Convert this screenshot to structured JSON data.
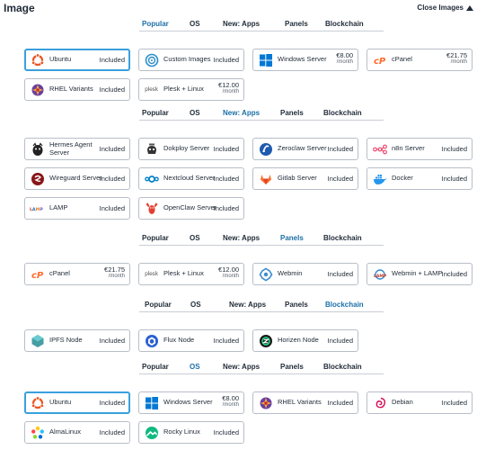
{
  "header": {
    "title": "Image",
    "close_label": "Close Images"
  },
  "tab_labels": {
    "popular": "Popular",
    "os": "OS",
    "apps": "New: Apps",
    "panels": "Panels",
    "blockchain": "Blockchain"
  },
  "sections": [
    {
      "active": "popular",
      "cards": [
        {
          "name": "Ubuntu",
          "price": "Included",
          "icon": "ubuntu-icon",
          "selected": true
        },
        {
          "name": "Custom Images",
          "price": "Included",
          "icon": "custom-images-icon"
        },
        {
          "name": "Windows Server",
          "price": "€8.00",
          "per": "/month",
          "icon": "windows-icon"
        },
        {
          "name": "cPanel",
          "price": "€21.75",
          "per": "/month",
          "icon": "cpanel-icon"
        },
        {
          "name": "RHEL Variants",
          "price": "Included",
          "icon": "rhel-icon"
        },
        {
          "name": "Plesk + Linux",
          "price": "€12.00",
          "per": "/month",
          "icon": "plesk-icon"
        }
      ]
    },
    {
      "active": "apps",
      "cards": [
        {
          "name": "Hermes Agent Server",
          "price": "Included",
          "icon": "hermes-icon"
        },
        {
          "name": "Dokploy Server",
          "price": "Included",
          "icon": "dokploy-icon"
        },
        {
          "name": "Zeroclaw Server",
          "price": "Included",
          "icon": "zeroclaw-icon"
        },
        {
          "name": "n8n Server",
          "price": "Included",
          "icon": "n8n-icon"
        },
        {
          "name": "Wireguard Server",
          "price": "Included",
          "icon": "wireguard-icon"
        },
        {
          "name": "Nextcloud Server",
          "price": "Included",
          "icon": "nextcloud-icon"
        },
        {
          "name": "Gitlab Server",
          "price": "Included",
          "icon": "gitlab-icon"
        },
        {
          "name": "Docker",
          "price": "Included",
          "icon": "docker-icon"
        },
        {
          "name": "LAMP",
          "price": "Included",
          "icon": "lamp-icon"
        },
        {
          "name": "OpenClaw Server",
          "price": "Included",
          "icon": "openclaw-icon"
        }
      ]
    },
    {
      "active": "panels",
      "cards": [
        {
          "name": "cPanel",
          "price": "€21.75",
          "per": "/month",
          "icon": "cpanel-icon"
        },
        {
          "name": "Plesk + Linux",
          "price": "€12.00",
          "per": "/month",
          "icon": "plesk-icon"
        },
        {
          "name": "Webmin",
          "price": "Included",
          "icon": "webmin-icon"
        },
        {
          "name": "Webmin + LAMP",
          "price": "Included",
          "icon": "webmin-lamp-icon"
        }
      ]
    },
    {
      "active": "blockchain",
      "cards": [
        {
          "name": "IPFS Node",
          "price": "Included",
          "icon": "ipfs-icon"
        },
        {
          "name": "Flux Node",
          "price": "Included",
          "icon": "flux-icon"
        },
        {
          "name": "Horizen Node",
          "price": "Included",
          "icon": "horizen-icon"
        }
      ]
    },
    {
      "active": "os",
      "cards": [
        {
          "name": "Ubuntu",
          "price": "Included",
          "icon": "ubuntu-icon",
          "selected": true
        },
        {
          "name": "Windows Server",
          "price": "€8.00",
          "per": "/month",
          "icon": "windows-icon"
        },
        {
          "name": "RHEL Variants",
          "price": "Included",
          "icon": "rhel-icon"
        },
        {
          "name": "Debian",
          "price": "Included",
          "icon": "debian-icon"
        },
        {
          "name": "AlmaLinux",
          "price": "Included",
          "icon": "almalinux-icon"
        },
        {
          "name": "Rocky Linux",
          "price": "Included",
          "icon": "rockylinux-icon"
        }
      ]
    }
  ],
  "plesk_logo_text": "plesk",
  "colors": {
    "accent": "#1b6fa8",
    "selected_border": "#3aa0dc",
    "card_border": "#b8bec8"
  }
}
